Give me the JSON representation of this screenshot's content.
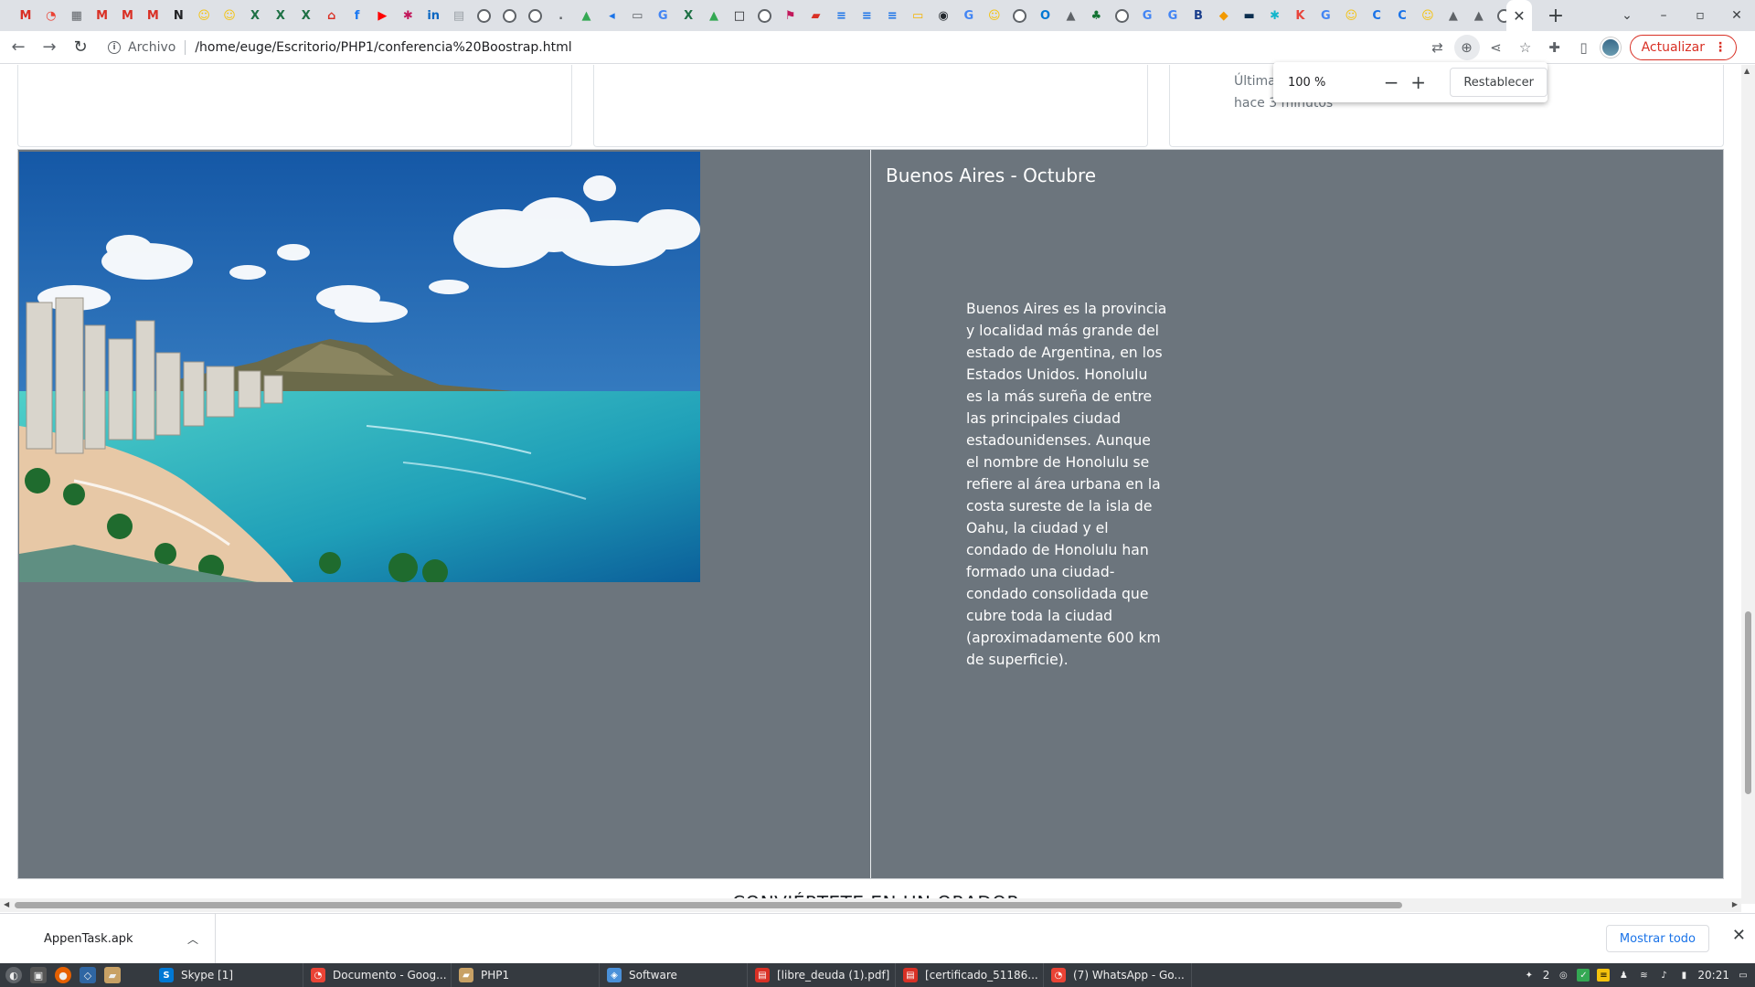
{
  "browser": {
    "tabs": [
      {
        "icon": "gmail-icon",
        "glyph": "M",
        "color": "#d93025"
      },
      {
        "icon": "chrome-icon",
        "glyph": "◔",
        "color": "#ea4335"
      },
      {
        "icon": "calculator-icon",
        "glyph": "▦",
        "color": "#5f6368"
      },
      {
        "icon": "gmail-icon",
        "glyph": "M",
        "color": "#d93025"
      },
      {
        "icon": "gmail-icon",
        "glyph": "M",
        "color": "#d93025"
      },
      {
        "icon": "gmail-icon",
        "glyph": "M",
        "color": "#d93025"
      },
      {
        "icon": "notion-icon",
        "glyph": "N",
        "color": "#202124"
      },
      {
        "icon": "emoji-icon",
        "glyph": "☺",
        "color": "#f4c20d"
      },
      {
        "icon": "emoji-icon",
        "glyph": "☺",
        "color": "#f4c20d"
      },
      {
        "icon": "excel-icon",
        "glyph": "X",
        "color": "#1e7145"
      },
      {
        "icon": "excel-icon",
        "glyph": "X",
        "color": "#1e7145"
      },
      {
        "icon": "excel-icon",
        "glyph": "X",
        "color": "#1e7145"
      },
      {
        "icon": "home-icon",
        "glyph": "⌂",
        "color": "#d93025"
      },
      {
        "icon": "facebook-icon",
        "glyph": "f",
        "color": "#1877f2"
      },
      {
        "icon": "youtube-icon",
        "glyph": "▶",
        "color": "#ff0000"
      },
      {
        "icon": "unknown-icon",
        "glyph": "✱",
        "color": "#c2185b"
      },
      {
        "icon": "linkedin-icon",
        "glyph": "in",
        "color": "#0a66c2"
      },
      {
        "icon": "newspaper-icon",
        "glyph": "▤",
        "color": "#9aa0a6"
      },
      {
        "icon": "globe-icon",
        "glyph": "",
        "color": "globe"
      },
      {
        "icon": "globe-icon",
        "glyph": "",
        "color": "globe"
      },
      {
        "icon": "globe-icon",
        "glyph": "",
        "color": "globe"
      },
      {
        "icon": "dot-icon",
        "glyph": ".",
        "color": "#5f6368"
      },
      {
        "icon": "drive-icon",
        "glyph": "▲",
        "color": "#34a853"
      },
      {
        "icon": "arrow-icon",
        "glyph": "◂",
        "color": "#1a73e8"
      },
      {
        "icon": "link-icon",
        "glyph": "▭",
        "color": "#5f6368"
      },
      {
        "icon": "google-icon",
        "glyph": "G",
        "color": "#4285f4"
      },
      {
        "icon": "excel-icon",
        "glyph": "X",
        "color": "#1e7145"
      },
      {
        "icon": "drive-icon",
        "glyph": "▲",
        "color": "#34a853"
      },
      {
        "icon": "window-icon",
        "glyph": "□",
        "color": "#202124"
      },
      {
        "icon": "globe-icon",
        "glyph": "",
        "color": "globe"
      },
      {
        "icon": "flag-icon",
        "glyph": "⚑",
        "color": "#c2185b"
      },
      {
        "icon": "folder-icon",
        "glyph": "▰",
        "color": "#d93025"
      },
      {
        "icon": "docs-icon",
        "glyph": "≡",
        "color": "#1a73e8"
      },
      {
        "icon": "docs-icon",
        "glyph": "≡",
        "color": "#1a73e8"
      },
      {
        "icon": "docs-icon",
        "glyph": "≡",
        "color": "#1a73e8"
      },
      {
        "icon": "slides-icon",
        "glyph": "▭",
        "color": "#f4b400"
      },
      {
        "icon": "github-icon",
        "glyph": "◉",
        "color": "#24292e"
      },
      {
        "icon": "google-icon",
        "glyph": "G",
        "color": "#4285f4"
      },
      {
        "icon": "emoji-icon",
        "glyph": "☺",
        "color": "#f4c20d"
      },
      {
        "icon": "globe-icon",
        "glyph": "",
        "color": "globe"
      },
      {
        "icon": "outlook-icon",
        "glyph": "O",
        "color": "#0078d4"
      },
      {
        "icon": "mountain-icon",
        "glyph": "▲",
        "color": "#5f6368"
      },
      {
        "icon": "tree-icon",
        "glyph": "♣",
        "color": "#137333"
      },
      {
        "icon": "globe-icon",
        "glyph": "",
        "color": "globe"
      },
      {
        "icon": "google-icon",
        "glyph": "G",
        "color": "#4285f4"
      },
      {
        "icon": "google-icon",
        "glyph": "G",
        "color": "#4285f4"
      },
      {
        "icon": "bold-b-icon",
        "glyph": "B",
        "color": "#1a3e8c"
      },
      {
        "icon": "diamond-icon",
        "glyph": "◆",
        "color": "#f29900"
      },
      {
        "icon": "terminal-icon",
        "glyph": "▬",
        "color": "#0b2e4f"
      },
      {
        "icon": "star-icon",
        "glyph": "✱",
        "color": "#12b5cb"
      },
      {
        "icon": "k-icon",
        "glyph": "K",
        "color": "#e8453c"
      },
      {
        "icon": "google-icon",
        "glyph": "G",
        "color": "#4285f4"
      },
      {
        "icon": "emoji-icon",
        "glyph": "☺",
        "color": "#f4c20d"
      },
      {
        "icon": "c-icon",
        "glyph": "C",
        "color": "#1a73e8"
      },
      {
        "icon": "c-icon",
        "glyph": "C",
        "color": "#1a73e8"
      },
      {
        "icon": "emoji-icon",
        "glyph": "☺",
        "color": "#f4c20d"
      },
      {
        "icon": "mountain-icon",
        "glyph": "▲",
        "color": "#5f6368"
      },
      {
        "icon": "mountain-icon",
        "glyph": "▲",
        "color": "#5f6368"
      },
      {
        "icon": "globe-icon",
        "glyph": "",
        "color": "globe"
      }
    ],
    "active_tab_close": "✕",
    "new_tab": "+",
    "address": {
      "scheme_label": "Archivo",
      "url": "/home/euge/Escritorio/PHP1/conferencia%20Boostrap.html"
    },
    "update_label": "Actualizar",
    "zoom_popup": {
      "value": "100 %",
      "minus": "−",
      "plus": "+",
      "reset_label": "Restablecer"
    }
  },
  "page": {
    "card_last_updated": "Última actualización hace 3 minutos",
    "feature": {
      "title": "Buenos Aires - Octubre",
      "description": "Buenos Aires es la provincia y localidad más grande del estado de Argentina, en los Estados Unidos. Honolulu es la más sureña de entre las principales ciudad estadounidenses. Aunque el nombre de Honolulu se refiere al área urbana en la costa sureste de la isla de Oahu, la ciudad y el condado de Honolulu han formado una ciudad-condado consolidada que cubre toda la ciudad (aproximadamente 600 km de superficie)."
    },
    "next_section_heading": "CONVIÉRTETE EN UN ORADOR"
  },
  "downloads": {
    "item_name": "AppenTask.apk",
    "show_all": "Mostrar todo"
  },
  "taskbar": {
    "tasks": [
      {
        "label": "Skype [1]",
        "icon": "skype-icon",
        "color": "#0078d4",
        "glyph": "S",
        "width": 166
      },
      {
        "label": "Documento - Goog...",
        "icon": "chrome-icon",
        "color": "#ea4335",
        "glyph": "◔",
        "width": 162
      },
      {
        "label": "PHP1",
        "icon": "folder-icon",
        "color": "#c8a165",
        "glyph": "▰",
        "width": 162
      },
      {
        "label": "Software",
        "icon": "software-icon",
        "color": "#4a90d9",
        "glyph": "◈",
        "width": 162
      },
      {
        "label": "[libre_deuda (1).pdf]",
        "icon": "pdf-icon",
        "color": "#d93025",
        "glyph": "▤",
        "width": 162
      },
      {
        "label": "[certificado_51186...",
        "icon": "pdf-icon",
        "color": "#d93025",
        "glyph": "▤",
        "width": 162
      },
      {
        "label": "(7) WhatsApp - Go...",
        "icon": "chrome-icon",
        "color": "#ea4335",
        "glyph": "◔",
        "width": 162
      }
    ],
    "tray_count": "2",
    "clock": "20:21"
  }
}
